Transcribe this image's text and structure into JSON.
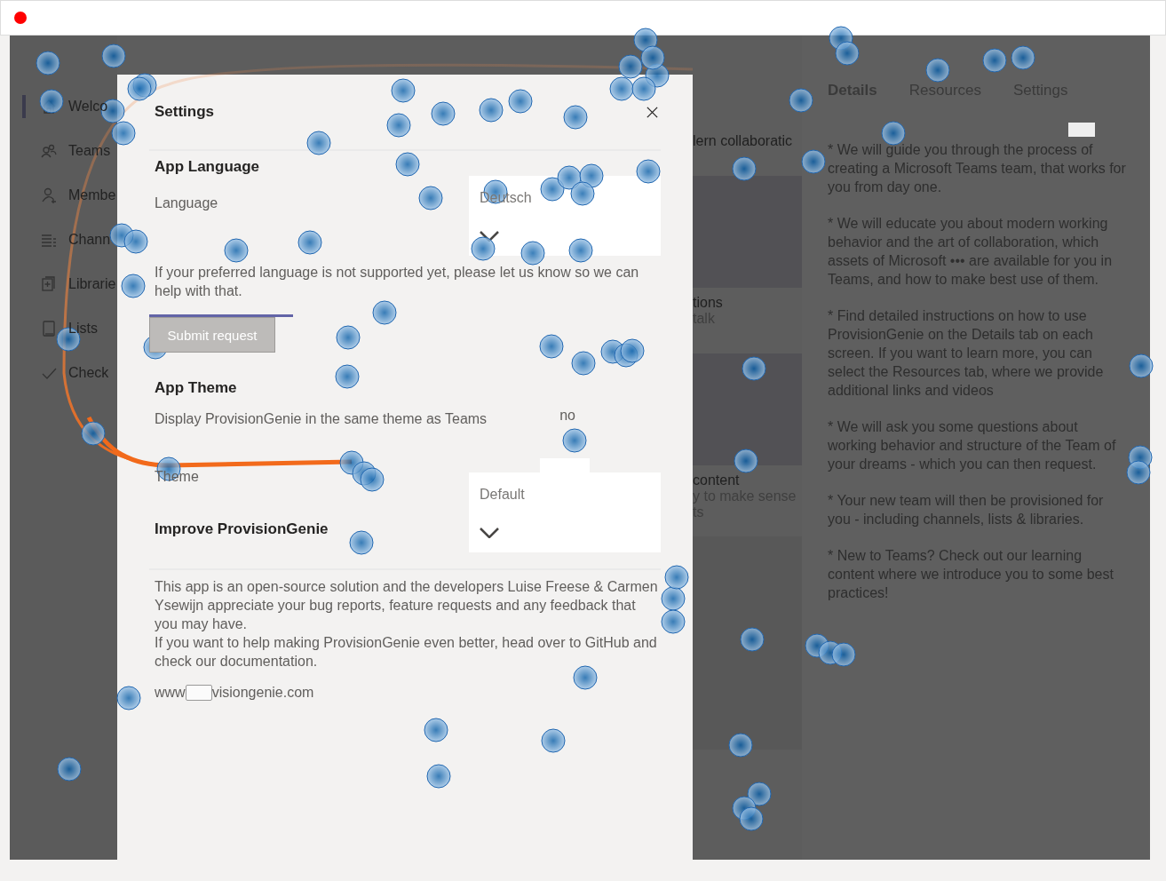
{
  "nav": {
    "items": [
      {
        "label": "Welco",
        "selected": true
      },
      {
        "label": "Teams",
        "selected": false
      },
      {
        "label": "Membe",
        "selected": false
      },
      {
        "label": "Chann",
        "selected": false
      },
      {
        "label": "Librarie",
        "selected": false
      },
      {
        "label": "Lists",
        "selected": false
      },
      {
        "label": "Check",
        "selected": false
      }
    ]
  },
  "middle": {
    "heading": "lern collaboratic",
    "cards": [
      {
        "title": "tions",
        "subtitle": "talk"
      },
      {
        "title": "content",
        "subtitle": "y to make sense",
        "extra": "ts"
      }
    ]
  },
  "dialog": {
    "title": "Settings",
    "language_section": {
      "heading": "App Language",
      "label": "Language",
      "value": "Deutsch",
      "help": "If your preferred language is not supported yet, please let us know so we can help with that.",
      "submit": {
        "label": "Submit request",
        "disabled": true
      }
    },
    "theme_section": {
      "heading": "App Theme",
      "label": "Display ProvisionGenie in the same theme as Teams",
      "toggle_value": "no",
      "theme_label": "Theme",
      "theme_value": "Default"
    },
    "improve_section": {
      "heading": "Improve ProvisionGenie",
      "paragraphs": [
        "This app is an open-source solution and the developers Luise Freese & Carmen Ysewijn appreciate your bug reports, feature requests and any feedback that you may have.",
        "If you want to help making ProvisionGenie even better, head over to GitHub and check our documentation."
      ],
      "link_prefix": "www",
      "link_suffix": "visiongenie.com"
    }
  },
  "details_panel": {
    "tabs": [
      {
        "label": "Details",
        "selected": true
      },
      {
        "label": "Resources",
        "selected": false
      },
      {
        "label": "Settings",
        "selected": false
      }
    ],
    "paragraphs": [
      "* We will guide you through the process of creating a Microsoft Teams team, that works for you from day one.",
      "* We will educate you about modern working behavior and the art of collaboration, which assets of Microsoft ••• are available for you in Teams, and how to make best use of them.",
      "* Find detailed instructions on how to use ProvisionGenie on the Details tab on each screen. If you want to learn more, you can select the Resources tab, where we provide additional links and videos",
      "* We will ask you some questions about working behavior and structure of the Team of your dreams - which you can then request.",
      "* Your new team will then be provisioned for you - including channels, lists & libraries.",
      "* New to Teams? Check out our learning content where we introduce you to some best practices!"
    ]
  }
}
